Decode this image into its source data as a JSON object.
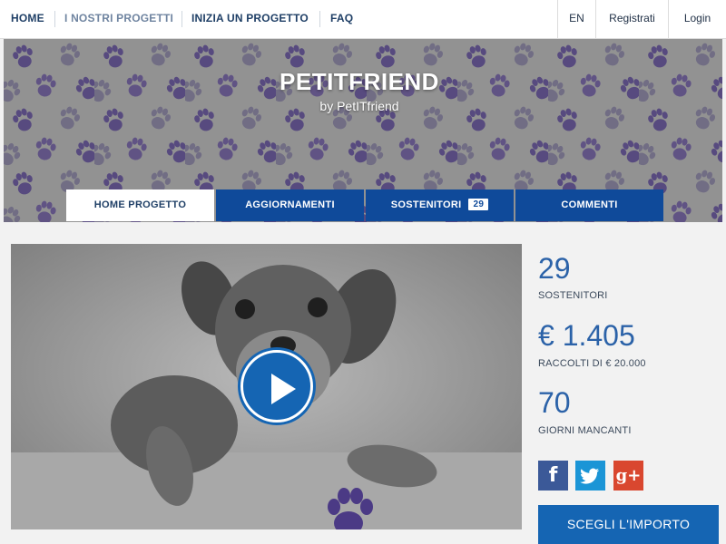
{
  "nav": {
    "home": "HOME",
    "projects": "I NOSTRI PROGETTI",
    "start": "INIZIA UN PROGETTO",
    "faq": "FAQ",
    "language": "EN",
    "register": "Registrati",
    "login": "Login"
  },
  "project": {
    "title": "PETITFRIEND",
    "byline": "by PetITfriend"
  },
  "tabs": {
    "home": "HOME PROGETTO",
    "updates": "AGGIORNAMENTI",
    "backers": "SOSTENITORI",
    "backers_count": "29",
    "comments": "COMMENTI"
  },
  "video": {
    "play_icon": "play-icon"
  },
  "stats": {
    "backers_value": "29",
    "backers_label": "SOSTENITORI",
    "raised_value": "€ 1.405",
    "raised_label": "RACCOLTI DI € 20.000",
    "days_value": "70",
    "days_label": "GIORNI MANCANTI"
  },
  "social": {
    "facebook_glyph": "f",
    "twitter_icon": "twitter-bird-icon",
    "googleplus_glyph": "g+",
    "facebook_color": "#3b5998",
    "twitter_color": "#1b95d6",
    "googleplus_color": "#d9472f"
  },
  "cta": {
    "label": "SCEGLI L'IMPORTO"
  },
  "colors": {
    "primary": "#0f4a9a",
    "accent": "#2b62a8",
    "paw_purple": "#4f3f7f",
    "paw_light": "#6e6a86"
  }
}
